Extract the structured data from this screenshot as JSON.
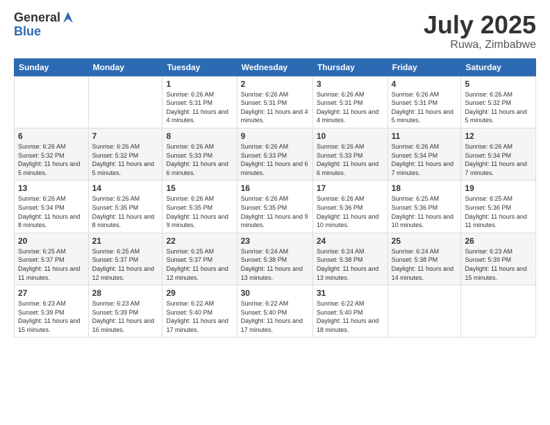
{
  "logo": {
    "general": "General",
    "blue": "Blue"
  },
  "title": {
    "month": "July 2025",
    "location": "Ruwa, Zimbabwe"
  },
  "headers": [
    "Sunday",
    "Monday",
    "Tuesday",
    "Wednesday",
    "Thursday",
    "Friday",
    "Saturday"
  ],
  "weeks": [
    [
      {
        "day": "",
        "info": ""
      },
      {
        "day": "",
        "info": ""
      },
      {
        "day": "1",
        "info": "Sunrise: 6:26 AM\nSunset: 5:31 PM\nDaylight: 11 hours and 4 minutes."
      },
      {
        "day": "2",
        "info": "Sunrise: 6:26 AM\nSunset: 5:31 PM\nDaylight: 11 hours and 4 minutes."
      },
      {
        "day": "3",
        "info": "Sunrise: 6:26 AM\nSunset: 5:31 PM\nDaylight: 11 hours and 4 minutes."
      },
      {
        "day": "4",
        "info": "Sunrise: 6:26 AM\nSunset: 5:31 PM\nDaylight: 11 hours and 5 minutes."
      },
      {
        "day": "5",
        "info": "Sunrise: 6:26 AM\nSunset: 5:32 PM\nDaylight: 11 hours and 5 minutes."
      }
    ],
    [
      {
        "day": "6",
        "info": "Sunrise: 6:26 AM\nSunset: 5:32 PM\nDaylight: 11 hours and 5 minutes."
      },
      {
        "day": "7",
        "info": "Sunrise: 6:26 AM\nSunset: 5:32 PM\nDaylight: 11 hours and 5 minutes."
      },
      {
        "day": "8",
        "info": "Sunrise: 6:26 AM\nSunset: 5:33 PM\nDaylight: 11 hours and 6 minutes."
      },
      {
        "day": "9",
        "info": "Sunrise: 6:26 AM\nSunset: 5:33 PM\nDaylight: 11 hours and 6 minutes."
      },
      {
        "day": "10",
        "info": "Sunrise: 6:26 AM\nSunset: 5:33 PM\nDaylight: 11 hours and 6 minutes."
      },
      {
        "day": "11",
        "info": "Sunrise: 6:26 AM\nSunset: 5:34 PM\nDaylight: 11 hours and 7 minutes."
      },
      {
        "day": "12",
        "info": "Sunrise: 6:26 AM\nSunset: 5:34 PM\nDaylight: 11 hours and 7 minutes."
      }
    ],
    [
      {
        "day": "13",
        "info": "Sunrise: 6:26 AM\nSunset: 5:34 PM\nDaylight: 11 hours and 8 minutes."
      },
      {
        "day": "14",
        "info": "Sunrise: 6:26 AM\nSunset: 5:35 PM\nDaylight: 11 hours and 8 minutes."
      },
      {
        "day": "15",
        "info": "Sunrise: 6:26 AM\nSunset: 5:35 PM\nDaylight: 11 hours and 9 minutes."
      },
      {
        "day": "16",
        "info": "Sunrise: 6:26 AM\nSunset: 5:35 PM\nDaylight: 11 hours and 9 minutes."
      },
      {
        "day": "17",
        "info": "Sunrise: 6:26 AM\nSunset: 5:36 PM\nDaylight: 11 hours and 10 minutes."
      },
      {
        "day": "18",
        "info": "Sunrise: 6:25 AM\nSunset: 5:36 PM\nDaylight: 11 hours and 10 minutes."
      },
      {
        "day": "19",
        "info": "Sunrise: 6:25 AM\nSunset: 5:36 PM\nDaylight: 11 hours and 11 minutes."
      }
    ],
    [
      {
        "day": "20",
        "info": "Sunrise: 6:25 AM\nSunset: 5:37 PM\nDaylight: 11 hours and 11 minutes."
      },
      {
        "day": "21",
        "info": "Sunrise: 6:25 AM\nSunset: 5:37 PM\nDaylight: 11 hours and 12 minutes."
      },
      {
        "day": "22",
        "info": "Sunrise: 6:25 AM\nSunset: 5:37 PM\nDaylight: 11 hours and 12 minutes."
      },
      {
        "day": "23",
        "info": "Sunrise: 6:24 AM\nSunset: 5:38 PM\nDaylight: 11 hours and 13 minutes."
      },
      {
        "day": "24",
        "info": "Sunrise: 6:24 AM\nSunset: 5:38 PM\nDaylight: 11 hours and 13 minutes."
      },
      {
        "day": "25",
        "info": "Sunrise: 6:24 AM\nSunset: 5:38 PM\nDaylight: 11 hours and 14 minutes."
      },
      {
        "day": "26",
        "info": "Sunrise: 6:23 AM\nSunset: 5:39 PM\nDaylight: 11 hours and 15 minutes."
      }
    ],
    [
      {
        "day": "27",
        "info": "Sunrise: 6:23 AM\nSunset: 5:39 PM\nDaylight: 11 hours and 15 minutes."
      },
      {
        "day": "28",
        "info": "Sunrise: 6:23 AM\nSunset: 5:39 PM\nDaylight: 11 hours and 16 minutes."
      },
      {
        "day": "29",
        "info": "Sunrise: 6:22 AM\nSunset: 5:40 PM\nDaylight: 11 hours and 17 minutes."
      },
      {
        "day": "30",
        "info": "Sunrise: 6:22 AM\nSunset: 5:40 PM\nDaylight: 11 hours and 17 minutes."
      },
      {
        "day": "31",
        "info": "Sunrise: 6:22 AM\nSunset: 5:40 PM\nDaylight: 11 hours and 18 minutes."
      },
      {
        "day": "",
        "info": ""
      },
      {
        "day": "",
        "info": ""
      }
    ]
  ]
}
